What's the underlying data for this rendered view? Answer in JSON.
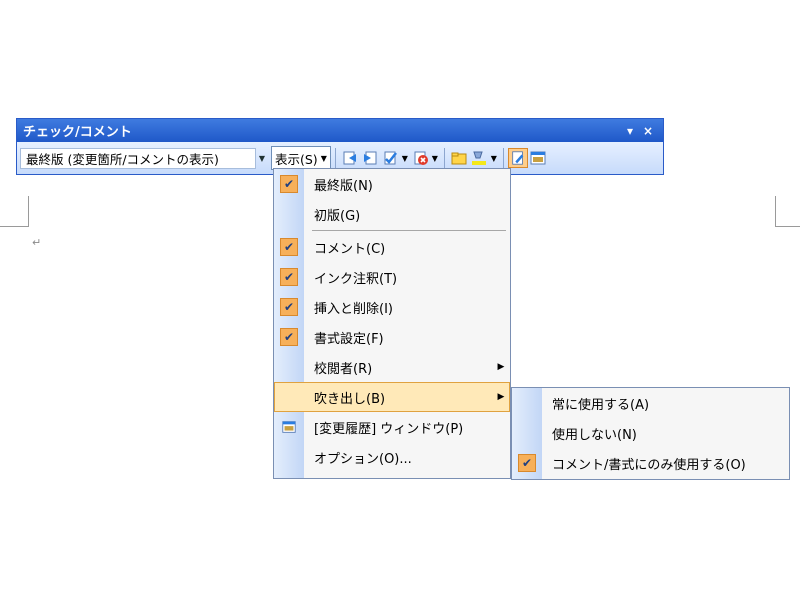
{
  "toolbar": {
    "title": "チェック/コメント",
    "title_controls": [
      "▾",
      "×"
    ],
    "display_mode_value": "最終版 (変更箇所/コメントの表示)",
    "show_button_label": "表示(S)",
    "icons": [
      "previous-change-icon",
      "next-change-icon",
      "accept-change-icon",
      "reject-change-icon",
      "new-comment-icon",
      "highlight-icon",
      "track-changes-icon",
      "reviewing-pane-icon"
    ]
  },
  "show_menu": {
    "items": [
      {
        "label": "最終版(N)",
        "checked": true
      },
      {
        "label": "初版(G)",
        "checked": false
      },
      {
        "label": "コメント(C)",
        "checked": true
      },
      {
        "label": "インク注釈(T)",
        "checked": true
      },
      {
        "label": "挿入と削除(I)",
        "checked": true
      },
      {
        "label": "書式設定(F)",
        "checked": true
      },
      {
        "label": "校閲者(R)",
        "submenu": true
      },
      {
        "label": "吹き出し(B)",
        "submenu": true,
        "highlighted": true
      },
      {
        "label": "[変更履歴] ウィンドウ(P)",
        "icon": "reviewing-pane-icon"
      },
      {
        "label": "オプション(O)..."
      }
    ]
  },
  "balloons_submenu": {
    "items": [
      {
        "label": "常に使用する(A)",
        "checked": false
      },
      {
        "label": "使用しない(N)",
        "checked": false
      },
      {
        "label": "コメント/書式にのみ使用する(O)",
        "checked": true
      }
    ]
  },
  "document": {
    "paragraph_mark": "↵"
  },
  "colors": {
    "title_bar": "#2a62d0",
    "menu_highlight": "#ffe9b8",
    "check_bg": "#f7b05a"
  }
}
